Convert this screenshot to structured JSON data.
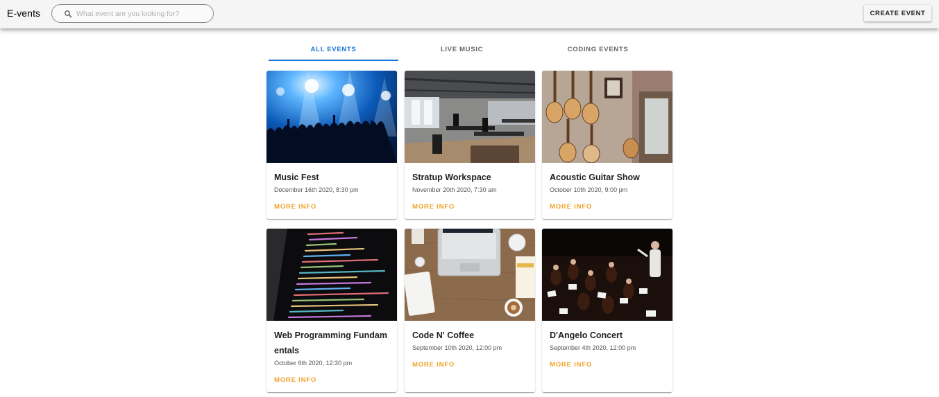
{
  "header": {
    "brand": "E-vents",
    "search_placeholder": "What event are you looking for?",
    "create_button": "CREATE EVENT"
  },
  "tabs": [
    {
      "label": "ALL EVENTS",
      "active": true
    },
    {
      "label": "LIVE MUSIC",
      "active": false
    },
    {
      "label": "CODING EVENTS",
      "active": false
    }
  ],
  "events": [
    {
      "title": "Music Fest",
      "date": "December 16th 2020, 8:30 pm",
      "action": "MORE INFO",
      "image": "concert-crowd"
    },
    {
      "title": "Stratup Workspace",
      "date": "November 20th 2020, 7:30 am",
      "action": "MORE INFO",
      "image": "office-workspace"
    },
    {
      "title": "Acoustic Guitar Show",
      "date": "October 10th 2020, 9:00 pm",
      "action": "MORE INFO",
      "image": "guitar-wall"
    },
    {
      "title": "Web Programming Fundamentals",
      "date": "October 6th 2020, 12:30 pm",
      "action": "MORE INFO",
      "image": "code-screen"
    },
    {
      "title": "Code N' Coffee",
      "date": "September 10th 2020, 12:00 pm",
      "action": "MORE INFO",
      "image": "laptop-coffee"
    },
    {
      "title": "D'Angelo Concert",
      "date": "September 4th 2020, 12:00 pm",
      "action": "MORE INFO",
      "image": "orchestra"
    }
  ],
  "colors": {
    "accent": "#1976d2",
    "more_info": "#f0a22a",
    "appbar": "#f5f5f5"
  }
}
